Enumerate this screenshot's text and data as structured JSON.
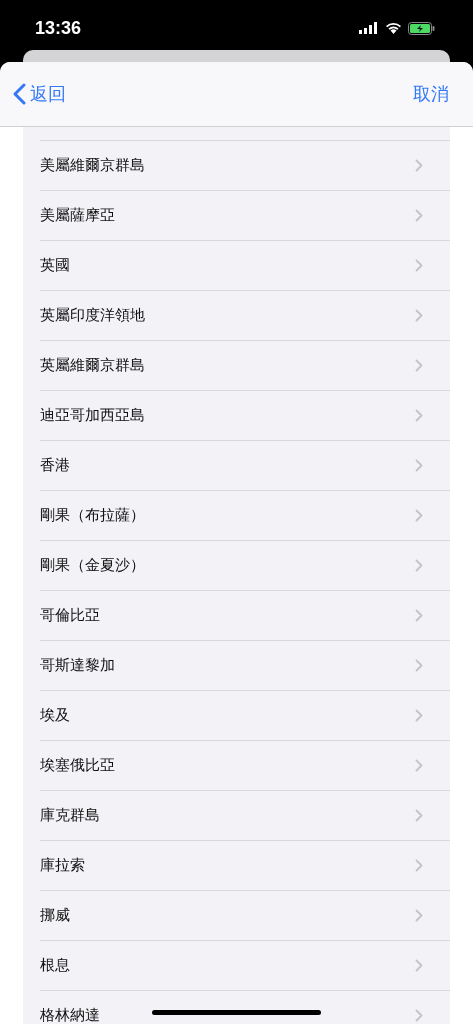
{
  "status_bar": {
    "time": "13:36"
  },
  "nav": {
    "back": "返回",
    "cancel": "取消"
  },
  "rows": [
    {
      "label": "美屬維爾京群島"
    },
    {
      "label": "美屬薩摩亞"
    },
    {
      "label": "英國"
    },
    {
      "label": "英屬印度洋領地"
    },
    {
      "label": "英屬維爾京群島"
    },
    {
      "label": "迪亞哥加西亞島"
    },
    {
      "label": "香港"
    },
    {
      "label": "剛果（布拉薩）"
    },
    {
      "label": "剛果（金夏沙）"
    },
    {
      "label": "哥倫比亞"
    },
    {
      "label": "哥斯達黎加"
    },
    {
      "label": "埃及"
    },
    {
      "label": "埃塞俄比亞"
    },
    {
      "label": "庫克群島"
    },
    {
      "label": "庫拉索"
    },
    {
      "label": "挪威"
    },
    {
      "label": "根息"
    },
    {
      "label": "格林納達"
    }
  ]
}
